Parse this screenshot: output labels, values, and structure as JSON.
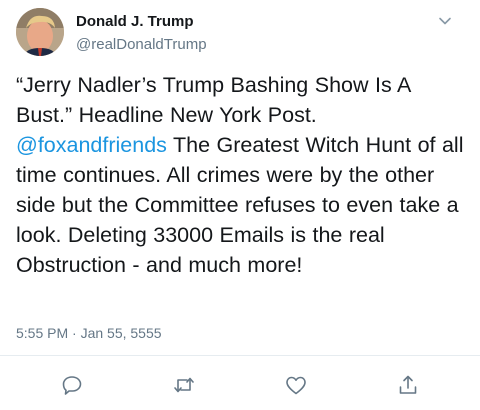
{
  "tweet": {
    "author": {
      "name": "Donald J. Trump",
      "handle": "@realDonaldTrump",
      "avatar_icon": "profile-photo"
    },
    "text": {
      "part1": "“Jerry Nadler’s Trump Bashing Show Is A Bust.” Headline New York Post. ",
      "mention": "@foxandfriends",
      "part2": " The Greatest Witch Hunt of all time continues. All crimes were by the other side but the Committee refuses to even take a look. Deleting 33000 Emails is the real Obstruction - and much more!"
    },
    "timestamp": "5:55 PM · Jan 55, 5555",
    "menu_icon": "chevron-down-icon",
    "actions": [
      "reply-icon",
      "retweet-icon",
      "like-icon",
      "share-icon"
    ],
    "colors": {
      "text": "#14171a",
      "secondary": "#657786",
      "link": "#1b95e0",
      "divider": "#e6ecf0"
    }
  }
}
